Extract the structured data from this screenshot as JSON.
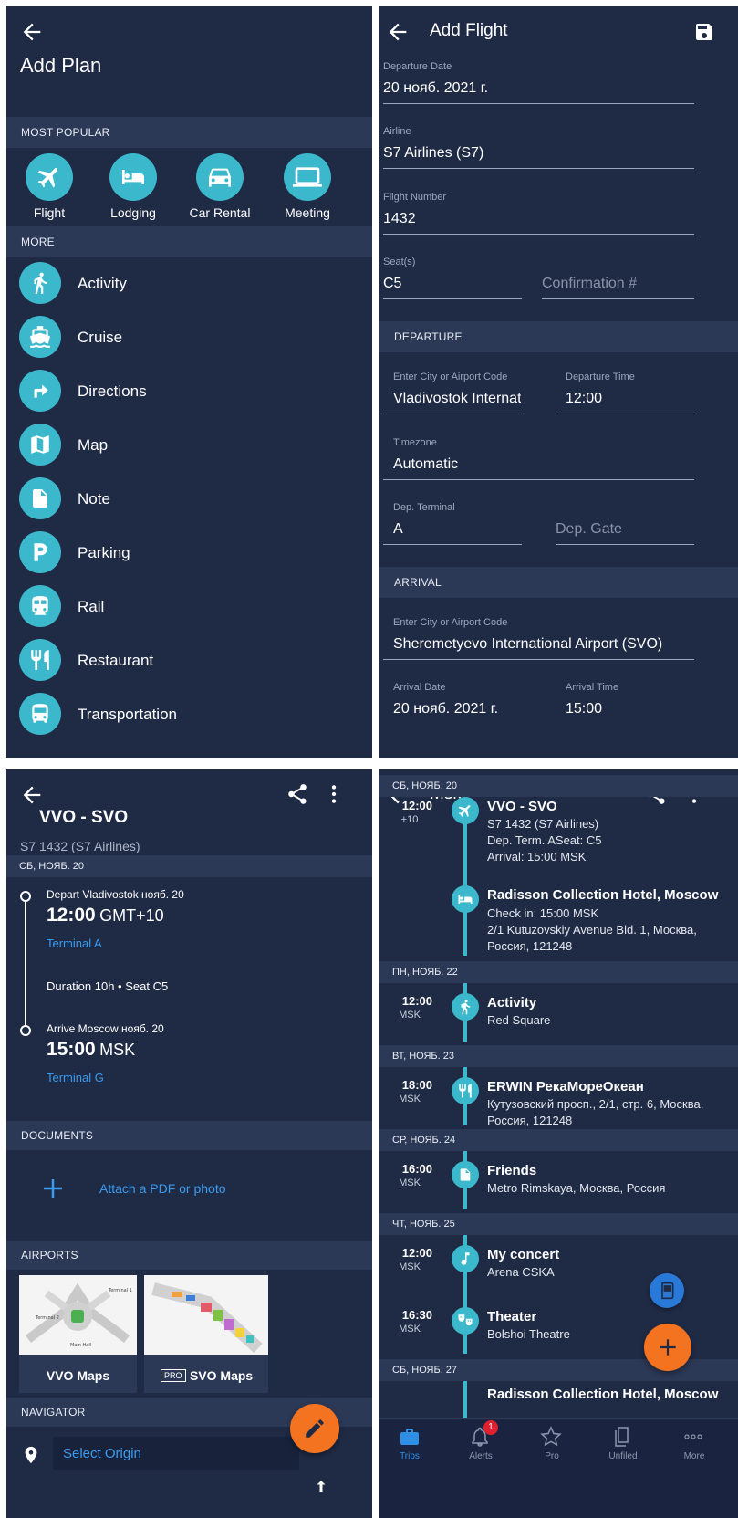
{
  "add_plan": {
    "title": "Add Plan",
    "most_popular_header": "MOST POPULAR",
    "popular": [
      "Flight",
      "Lodging",
      "Car Rental",
      "Meeting"
    ],
    "more_header": "MORE",
    "more_items": [
      "Activity",
      "Cruise",
      "Directions",
      "Map",
      "Note",
      "Parking",
      "Rail",
      "Restaurant",
      "Transportation"
    ]
  },
  "add_flight": {
    "title": "Add Flight",
    "departure_date_label": "Departure Date",
    "departure_date": "20 нояб. 2021 г.",
    "airline_label": "Airline",
    "airline": "S7 Airlines (S7)",
    "flight_number_label": "Flight Number",
    "flight_number": "1432",
    "seats_label": "Seat(s)",
    "seats": "C5",
    "confirmation_placeholder": "Confirmation #",
    "departure_header": "DEPARTURE",
    "dep_city_label": "Enter City or Airport Code",
    "dep_city": "Vladivostok International Airport (VVO)",
    "dep_time_label": "Departure Time",
    "dep_time": "12:00",
    "timezone_label": "Timezone",
    "timezone": "Automatic",
    "dep_terminal_label": "Dep. Terminal",
    "dep_terminal": "A",
    "dep_gate_placeholder": "Dep. Gate",
    "arrival_header": "ARRIVAL",
    "arr_city_label": "Enter City or Airport Code",
    "arr_city": "Sheremetyevo International Airport (SVO)",
    "arr_date_label": "Arrival Date",
    "arr_date": "20 нояб. 2021 г.",
    "arr_time_label": "Arrival Time",
    "arr_time": "15:00"
  },
  "flight_detail": {
    "title": "VVO - SVO",
    "subtitle": "S7 1432 (S7 Airlines)",
    "date_header": "СБ, НОЯБ. 20",
    "depart_label": "Depart Vladivostok нояб. 20",
    "depart_time": "12:00",
    "depart_tz": "GMT+10",
    "depart_terminal": "Terminal A",
    "duration": "Duration 10h • Seat C5",
    "arrive_label": "Arrive Moscow нояб. 20",
    "arrive_time": "15:00",
    "arrive_tz": "MSK",
    "arrive_terminal": "Terminal G",
    "documents_header": "DOCUMENTS",
    "attach_label": "Attach a PDF or photo",
    "airports_header": "AIRPORTS",
    "vvo_maps": "VVO Maps",
    "pro_badge": "PRO",
    "svo_maps": "SVO Maps",
    "navigator_header": "NAVIGATOR",
    "select_origin": "Select Origin"
  },
  "trip": {
    "title": "Msk",
    "days": [
      {
        "header": "СБ, НОЯБ. 20",
        "items": [
          {
            "time": "12:00",
            "tz": "+10",
            "icon": "plane-icon",
            "title": "VVO - SVO",
            "lines": [
              "S7 1432 (S7 Airlines)",
              "Dep. Term. ASeat: C5",
              "Arrival: 15:00 MSK"
            ]
          },
          {
            "time": "",
            "tz": "",
            "icon": "bed-icon",
            "title": "Radisson Collection Hotel, Moscow",
            "lines": [
              "Check in: 15:00 MSK",
              "2/1 Kutuzovskiy Avenue Bld. 1, Москва, Россия, 121248"
            ]
          }
        ]
      },
      {
        "header": "ПН, НОЯБ. 22",
        "items": [
          {
            "time": "12:00",
            "tz": "MSK",
            "icon": "walking-person-icon",
            "title": "Activity",
            "lines": [
              "Red Square"
            ]
          }
        ]
      },
      {
        "header": "ВТ, НОЯБ. 23",
        "items": [
          {
            "time": "18:00",
            "tz": "MSK",
            "icon": "fork-knife-icon",
            "title": "ERWIN РекаМореОкеан",
            "lines": [
              "Кутузовский просп., 2/1, стр. 6, Москва, Россия, 121248"
            ]
          }
        ]
      },
      {
        "header": "СР, НОЯБ. 24",
        "items": [
          {
            "time": "16:00",
            "tz": "MSK",
            "icon": "note-icon",
            "title": "Friends",
            "lines": [
              "Metro Rimskaya, Москва, Россия"
            ]
          }
        ]
      },
      {
        "header": "ЧТ, НОЯБ. 25",
        "items": [
          {
            "time": "12:00",
            "tz": "MSK",
            "icon": "music-note-icon",
            "title": "My concert",
            "lines": [
              "Arena CSKA"
            ]
          },
          {
            "time": "16:30",
            "tz": "MSK",
            "icon": "theater-masks-icon",
            "title": "Theater",
            "lines": [
              "Bolshoi Theatre"
            ]
          }
        ]
      },
      {
        "header": "СБ, НОЯБ. 27",
        "items": [
          {
            "time": "",
            "tz": "",
            "icon": "bed-icon",
            "title": "Radisson Collection Hotel, Moscow",
            "lines": []
          }
        ]
      }
    ],
    "alerts_badge": "1",
    "bottom_nav": [
      "Trips",
      "Alerts",
      "Pro",
      "Unfiled",
      "More"
    ]
  },
  "colors": {
    "background": "#1f2a44",
    "section": "#2b3856",
    "accent_teal": "#3bb8cc",
    "link_blue": "#3a9bf0",
    "fab_orange": "#f47321"
  }
}
